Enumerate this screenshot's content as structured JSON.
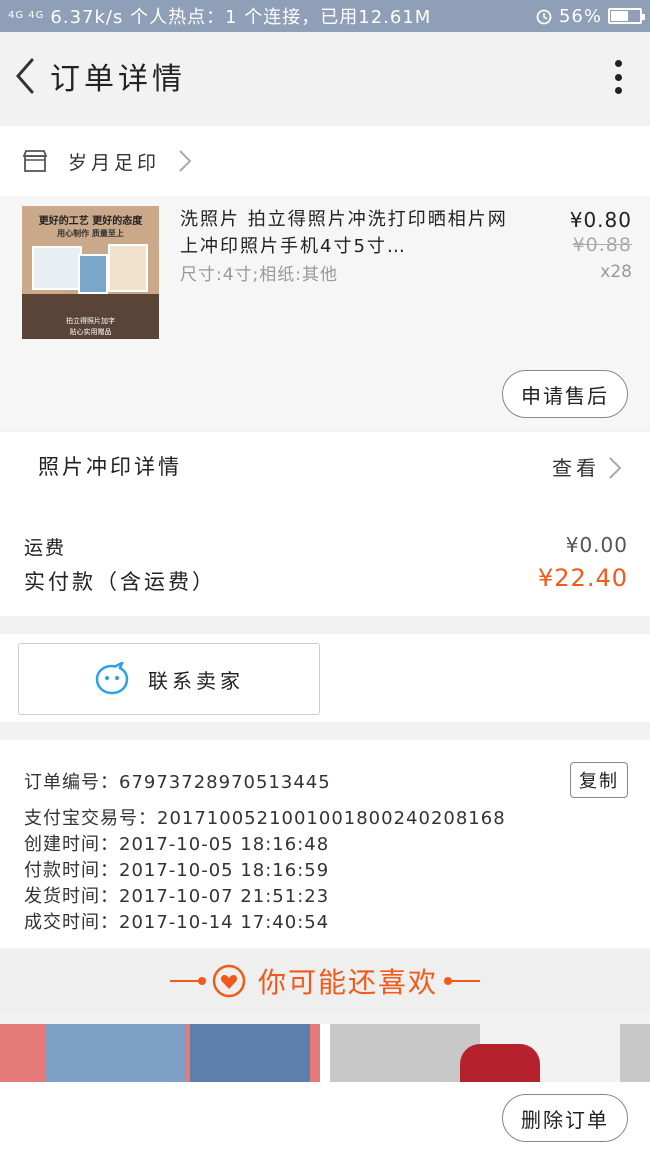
{
  "status_bar": {
    "signal": "4G 4G",
    "text": "6.37k/s 个人热点：1 个连接，已用12.61M",
    "battery": "56%"
  },
  "nav": {
    "title": "订单详情"
  },
  "shop": {
    "name": "岁月足印"
  },
  "product": {
    "image_lines": [
      "更好的工艺 更好的态度",
      "用心制作  质量至上",
      "拍立得照片加字",
      "贴心实用赠品"
    ],
    "title": "洗照片 拍立得照片冲洗打印晒相片网上冲印照片手机4寸5寸…",
    "spec": "尺寸:4寸;相纸:其他",
    "price": "¥0.80",
    "original_price": "¥0.88",
    "quantity": "x28",
    "after_sale_label": "申请售后"
  },
  "print_details": {
    "label": "照片冲印详情",
    "view_label": "查看"
  },
  "fees": {
    "shipping_label": "运费",
    "shipping_value": "¥0.00",
    "paid_label": "实付款（含运费）",
    "paid_value": "¥22.40"
  },
  "contact": {
    "label": "联系卖家"
  },
  "order_info": {
    "order_no": "订单编号：67973728970513445",
    "alipay_no": "支付宝交易号：2017100521001001800240208168",
    "created": "创建时间：2017-10-05 18:16:48",
    "paid": "付款时间：2017-10-05 18:16:59",
    "shipped": "发货时间：2017-10-07 21:51:23",
    "completed": "成交时间：2017-10-14 17:40:54",
    "copy_label": "复制"
  },
  "recommend": {
    "title": "你可能还喜欢"
  },
  "bottom": {
    "delete_label": "删除订单"
  },
  "colors": {
    "accent": "#f25a1a",
    "status_bar": "#8f9fb8",
    "contact_icon": "#2aa1e8"
  }
}
